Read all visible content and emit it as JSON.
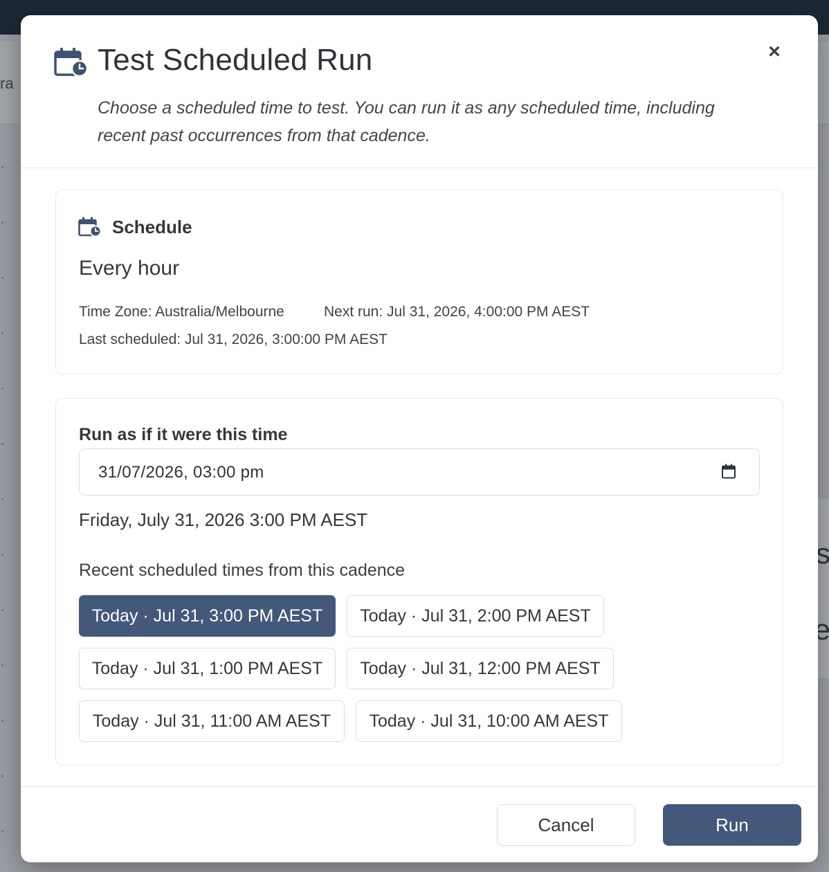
{
  "background": {
    "left_fragment": "ra",
    "right_fragment_1": "s",
    "right_fragment_2": "e"
  },
  "modal": {
    "title": "Test Scheduled Run",
    "subtitle": "Choose a scheduled time to test. You can run it as any scheduled time, including recent past occurrences from that cadence.",
    "close_label": "×",
    "icons": {
      "title": "calendar-clock-icon",
      "close": "close-icon"
    }
  },
  "schedule": {
    "heading": "Schedule",
    "cadence": "Every hour",
    "time_zone": "Time Zone: Australia/Melbourne",
    "next_run": "Next run: Jul 31, 2026, 4:00:00 PM AEST",
    "last_scheduled": "Last scheduled: Jul 31, 2026, 3:00:00 PM AEST",
    "icon": "calendar-clock-icon"
  },
  "run_as": {
    "label": "Run as if it were this time",
    "input_value": "31/07/2026, 03:00 pm",
    "readable": "Friday, July 31, 2026 3:00 PM AEST",
    "recent_label": "Recent scheduled times from this cadence",
    "icon": "calendar-icon",
    "options": [
      {
        "label": "Today · Jul 31, 3:00 PM AEST",
        "selected": true
      },
      {
        "label": "Today · Jul 31, 2:00 PM AEST",
        "selected": false
      },
      {
        "label": "Today · Jul 31, 1:00 PM AEST",
        "selected": false
      },
      {
        "label": "Today · Jul 31, 12:00 PM AEST",
        "selected": false
      },
      {
        "label": "Today · Jul 31, 11:00 AM AEST",
        "selected": false
      },
      {
        "label": "Today · Jul 31, 10:00 AM AEST",
        "selected": false
      }
    ]
  },
  "footer": {
    "cancel_label": "Cancel",
    "run_label": "Run"
  },
  "colors": {
    "accent": "#43587a",
    "topbar": "#1d2836",
    "overlay": "#9b9ea4"
  }
}
